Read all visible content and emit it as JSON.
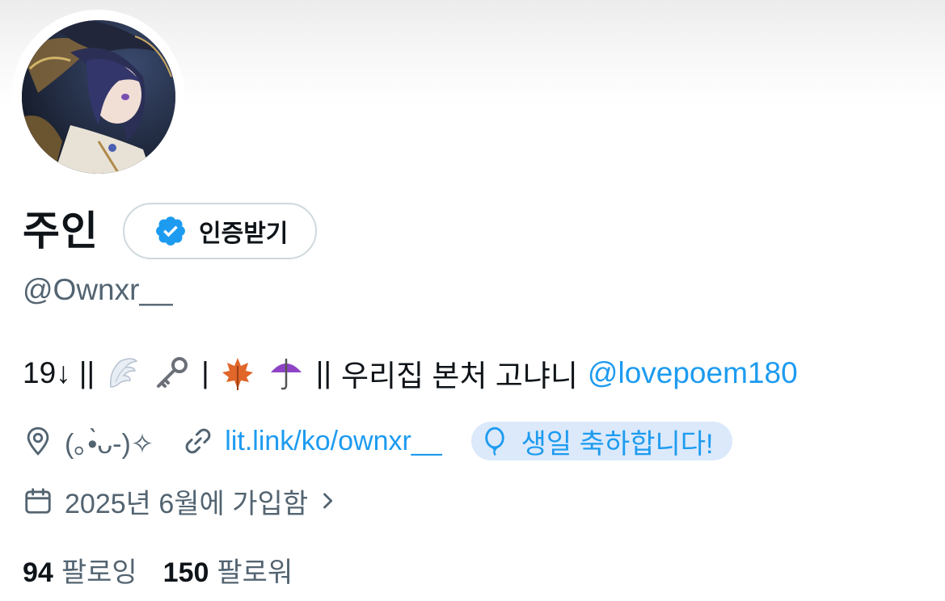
{
  "profile": {
    "display_name": "주인",
    "verify_label": "인증받기",
    "handle": "@Ownxr__"
  },
  "bio": {
    "prefix": "19↓ ||",
    "sep1": "|",
    "sep2": "||",
    "text": "우리집 본처 고냐니",
    "mention": "@lovepoem180",
    "emojis": [
      "wing-icon",
      "key-icon",
      "maple-leaf-icon",
      "umbrella-icon"
    ]
  },
  "meta": {
    "location": "(｡•̀ᴗ-)✧",
    "link": "lit.link/ko/ownxr__",
    "birthday": "생일 축하합니다!"
  },
  "joined": "2025년 6월에 가입함",
  "stats": {
    "following_count": "94",
    "following_label": "팔로잉",
    "followers_count": "150",
    "followers_label": "팔로워"
  },
  "colors": {
    "accent": "#1d9bf0",
    "muted": "#536471",
    "text": "#0f1419",
    "birthday_bg": "#dbe9fb"
  }
}
